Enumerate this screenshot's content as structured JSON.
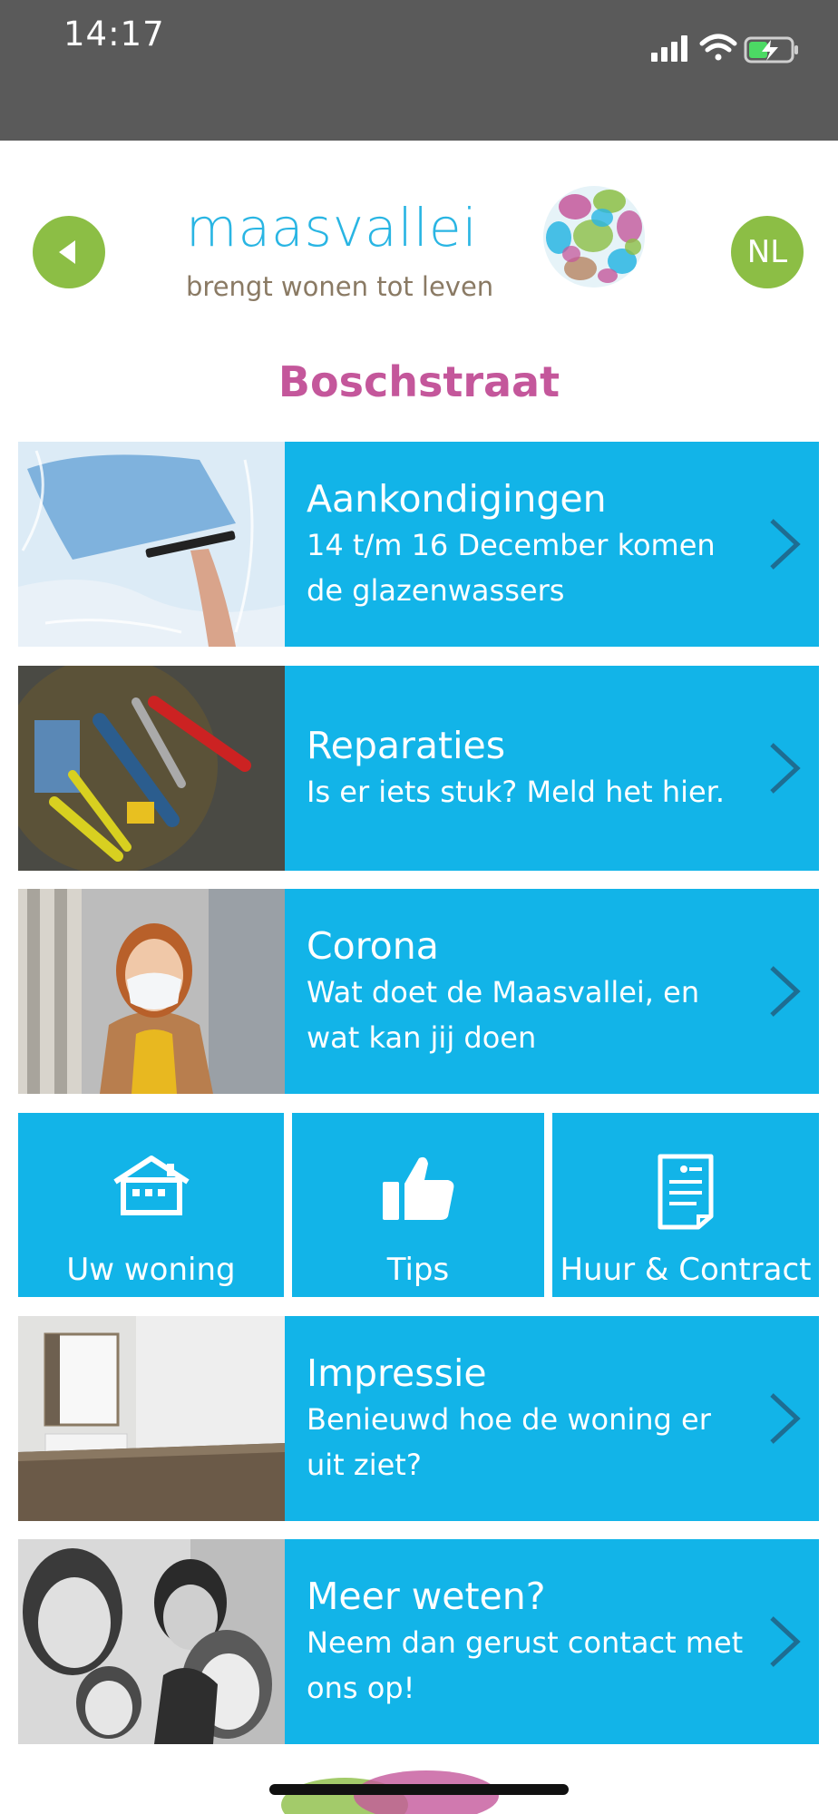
{
  "status": {
    "time": "14:17"
  },
  "header": {
    "logo_word": "maasvallei",
    "logo_tagline": "brengt wonen tot leven",
    "lang": "NL"
  },
  "page_title": "Boschstraat",
  "tiles": [
    {
      "title": "Aankondigingen",
      "subtitle": "14 t/m 16 December komen de glazenwassers"
    },
    {
      "title": "Reparaties",
      "subtitle": "Is er iets stuk? Meld het hier."
    },
    {
      "title": "Corona",
      "subtitle": "Wat doet de Maasvallei, en wat kan jij doen"
    },
    {
      "title": "Impressie",
      "subtitle": "Benieuwd hoe de woning er uit ziet?"
    },
    {
      "title": "Meer weten?",
      "subtitle": "Neem dan gerust contact met ons op!"
    }
  ],
  "grid": [
    {
      "label": "Uw woning",
      "icon": "house-icon"
    },
    {
      "label": "Tips",
      "icon": "thumbs-up-icon"
    },
    {
      "label": "Huur & Contract",
      "icon": "document-icon"
    }
  ],
  "colors": {
    "tile": "#12b4e8",
    "accent_green": "#8cbe45",
    "title_pink": "#c4579b",
    "logo_blue": "#29b5e3"
  }
}
